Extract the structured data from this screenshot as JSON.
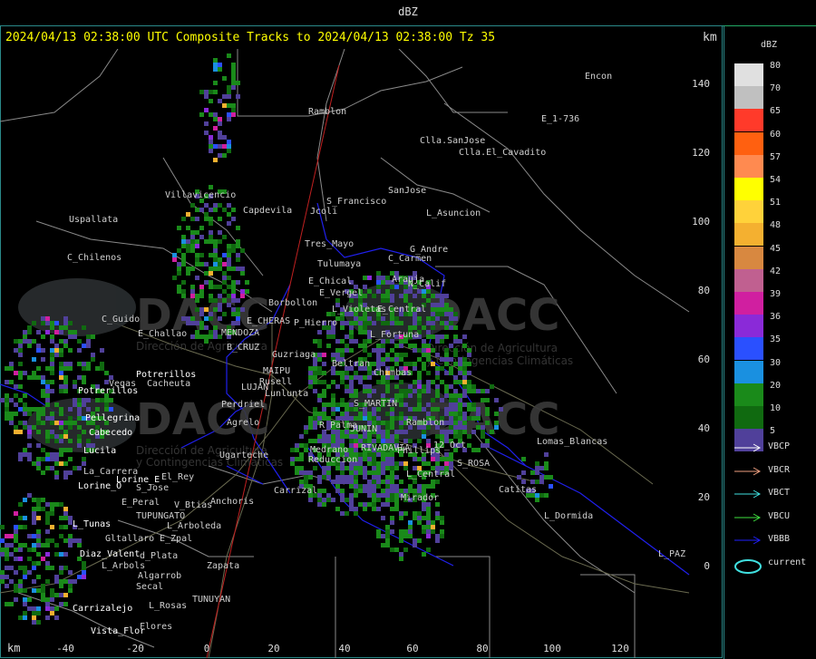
{
  "window": {
    "title": "dBZ"
  },
  "header": {
    "text": "2024/04/13 02:38:00 UTC Composite Tracks to 2024/04/13 02:38:00 Tz 35",
    "km_top": "km",
    "km_bottom": "km"
  },
  "axes": {
    "x_ticks": [
      "-40",
      "-20",
      "0",
      "20",
      "40",
      "60",
      "80",
      "100",
      "120"
    ],
    "y_ticks": [
      "140",
      "120",
      "100",
      "80",
      "60",
      "40",
      "20",
      "0"
    ]
  },
  "places": [
    {
      "name": "Ramblon"
    },
    {
      "name": "Encon"
    },
    {
      "name": "E_1-736"
    },
    {
      "name": "Clla.SanJose"
    },
    {
      "name": "Clla.El_Cavadito"
    },
    {
      "name": "SanJose"
    },
    {
      "name": "S_Francisco"
    },
    {
      "name": "Jcoli"
    },
    {
      "name": "L_Asuncion"
    },
    {
      "name": "Villavicencio"
    },
    {
      "name": "Uspallata"
    },
    {
      "name": "Capdevila"
    },
    {
      "name": "C_Chilenos"
    },
    {
      "name": "Tres_Mayo"
    },
    {
      "name": "G_Andre"
    },
    {
      "name": "Tulumaya"
    },
    {
      "name": "C_Carmen"
    },
    {
      "name": "E_Chical"
    },
    {
      "name": "Arauja"
    },
    {
      "name": "E_Vergel"
    },
    {
      "name": "N_Calif"
    },
    {
      "name": "Borbollon"
    },
    {
      "name": "E_Central"
    },
    {
      "name": "C_Guido"
    },
    {
      "name": "E_CHERAS"
    },
    {
      "name": "MENDOZA"
    },
    {
      "name": "P_Hierro"
    },
    {
      "name": "L_Violetas"
    },
    {
      "name": "E_Challao"
    },
    {
      "name": "B_CRUZ"
    },
    {
      "name": "Guzriaga"
    },
    {
      "name": "L_Fortuna"
    },
    {
      "name": "Potrerillos"
    },
    {
      "name": "MAIPU"
    },
    {
      "name": "Rusell"
    },
    {
      "name": "Vegas"
    },
    {
      "name": "Cacheuta"
    },
    {
      "name": "LUJAN"
    },
    {
      "name": "Lunlunta"
    },
    {
      "name": "Chimbas"
    },
    {
      "name": "Potrerillos"
    },
    {
      "name": "Perdriel"
    },
    {
      "name": "Beltran"
    },
    {
      "name": "S_MARTIN"
    },
    {
      "name": "Pellegrina"
    },
    {
      "name": "Agrelo"
    },
    {
      "name": "R_Palma"
    },
    {
      "name": "JUNIN"
    },
    {
      "name": "Ramblon"
    },
    {
      "name": "Cabecedo"
    },
    {
      "name": "Medrano"
    },
    {
      "name": "RIVADAVIA"
    },
    {
      "name": "Phillips"
    },
    {
      "name": "12_Oct"
    },
    {
      "name": "Lucila"
    },
    {
      "name": "Ugarteche"
    },
    {
      "name": "Reduccion"
    },
    {
      "name": "Lomas_Blancas"
    },
    {
      "name": "S_ROSA"
    },
    {
      "name": "La_Carrera"
    },
    {
      "name": "Lorine_E"
    },
    {
      "name": "El_Rey"
    },
    {
      "name": "L_Central"
    },
    {
      "name": "Lorine_O"
    },
    {
      "name": "S_Jose"
    },
    {
      "name": "Carrizal"
    },
    {
      "name": "Catitas"
    },
    {
      "name": "Anchoris"
    },
    {
      "name": "E_Peral"
    },
    {
      "name": "V_Btias"
    },
    {
      "name": "Mirador"
    },
    {
      "name": "TUPUNGATO"
    },
    {
      "name": "L_Dormida"
    },
    {
      "name": "L_Tunas"
    },
    {
      "name": "L_Arboleda"
    },
    {
      "name": "Gltallaro"
    },
    {
      "name": "E_Zpal"
    },
    {
      "name": "Diaz_Valent"
    },
    {
      "name": "d_Plata"
    },
    {
      "name": "L_PAZ"
    },
    {
      "name": "L_Arbols"
    },
    {
      "name": "Zapata"
    },
    {
      "name": "Algarrob"
    },
    {
      "name": "Secal"
    },
    {
      "name": "Carrizalejo"
    },
    {
      "name": "L_Rosas"
    },
    {
      "name": "TUNUYAN"
    },
    {
      "name": "Vista_Flor"
    },
    {
      "name": "Flores"
    }
  ],
  "watermark": {
    "text": "DACC",
    "sub1": "Dirección de Agricultura",
    "sub2": "y Contingencias Climáticas"
  },
  "legend": {
    "title": "dBZ",
    "bins": [
      {
        "label": "80",
        "color": "#e0e0e0"
      },
      {
        "label": "70",
        "color": "#c0c0c0"
      },
      {
        "label": "65",
        "color": "#ff3a2a"
      },
      {
        "label": "60",
        "color": "#ff6010"
      },
      {
        "label": "57",
        "color": "#ff8a50"
      },
      {
        "label": "54",
        "color": "#ffff00"
      },
      {
        "label": "51",
        "color": "#ffd23a"
      },
      {
        "label": "48",
        "color": "#f4b030"
      },
      {
        "label": "45",
        "color": "#d88840"
      },
      {
        "label": "42",
        "color": "#c06090"
      },
      {
        "label": "39",
        "color": "#d01fa0"
      },
      {
        "label": "36",
        "color": "#8a2ad8"
      },
      {
        "label": "35",
        "color": "#2a50ff"
      },
      {
        "label": "30",
        "color": "#1a90e0"
      },
      {
        "label": "20",
        "color": "#1a8a1a"
      },
      {
        "label": "10",
        "color": "#106a10"
      },
      {
        "label": "5",
        "color": "#50409a"
      }
    ],
    "tracks": [
      {
        "label": "VBCP",
        "color": "#ffffff"
      },
      {
        "label": "VBCR",
        "color": "#f0a080"
      },
      {
        "label": "VBCT",
        "color": "#40e0e0"
      },
      {
        "label": "VBCU",
        "color": "#40e040"
      },
      {
        "label": "VBBB",
        "color": "#2020ff"
      },
      {
        "label": "current",
        "color": "#40e0e0"
      }
    ]
  }
}
